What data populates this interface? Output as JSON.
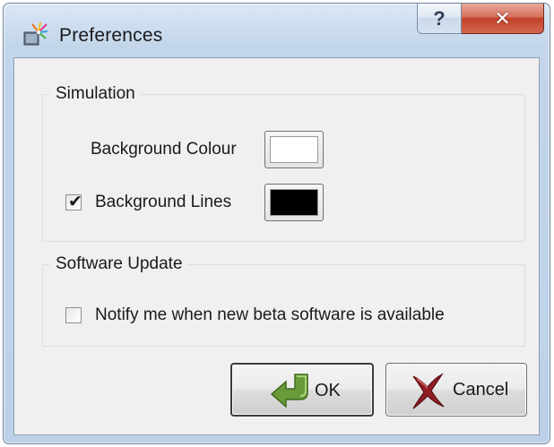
{
  "window": {
    "title": "Preferences",
    "app_icon": "preferences-app-icon",
    "help_button_glyph": "?",
    "close_button_glyph": "✕"
  },
  "simulation": {
    "group_label": "Simulation",
    "background_colour_label": "Background Colour",
    "background_colour_value": "#ffffff",
    "background_lines_label": "Background Lines",
    "background_lines_checked": true,
    "background_lines_colour_value": "#000000"
  },
  "software_update": {
    "group_label": "Software Update",
    "notify_beta_label": "Notify me when new beta software is available",
    "notify_beta_checked": false
  },
  "buttons": {
    "ok_label": "OK",
    "ok_icon": "green-arrow-icon",
    "cancel_label": "Cancel",
    "cancel_icon": "red-x-icon"
  },
  "colors": {
    "accent_close": "#c7432d",
    "ok_icon_green": "#6a9a3a",
    "cancel_icon_red": "#8e1e24"
  },
  "check_glyph": "✔"
}
